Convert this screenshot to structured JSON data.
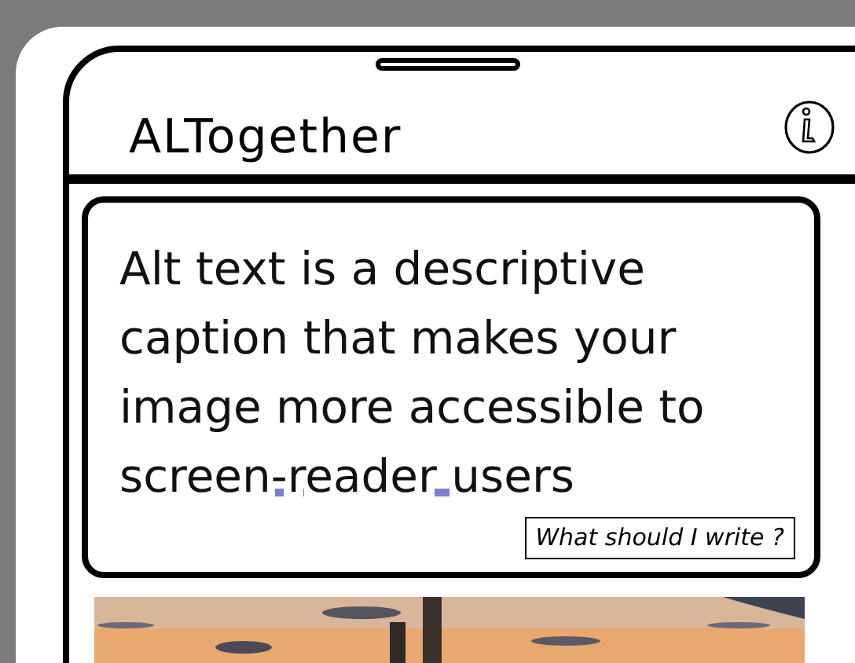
{
  "app_title": "ALTogether",
  "caption": {
    "text": "Alt text is a descriptive caption that makes your image more accessible to",
    "highlighted": "screen-reader users"
  },
  "help_button": "What should I write ?"
}
